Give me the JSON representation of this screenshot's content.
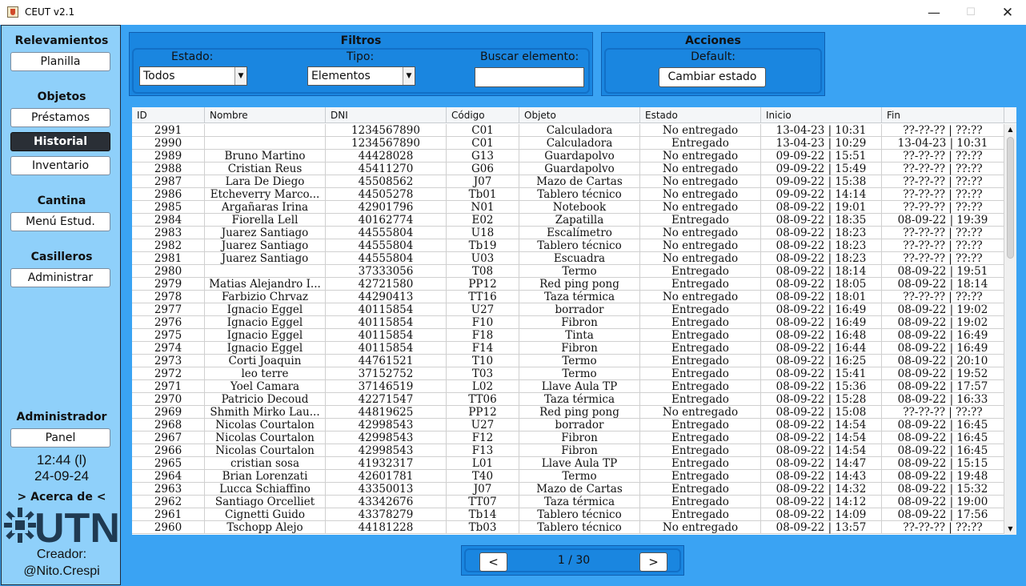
{
  "window": {
    "title": "CEUT v2.1",
    "min_icon": "—",
    "max_icon": "☐",
    "close_icon": "✕"
  },
  "sidebar": {
    "relevamientos": {
      "heading": "Relevamientos",
      "planilla": "Planilla"
    },
    "objetos": {
      "heading": "Objetos",
      "prestamos": "Préstamos",
      "historial": "Historial",
      "inventario": "Inventario"
    },
    "cantina": {
      "heading": "Cantina",
      "menu": "Menú Estud."
    },
    "casilleros": {
      "heading": "Casilleros",
      "administrar": "Administrar"
    },
    "administrador": {
      "heading": "Administrador",
      "panel": "Panel"
    },
    "clock_time": "12:44 (l)",
    "clock_date": "24-09-24",
    "acerca": "> Acerca de <",
    "logo_text": "UTN",
    "creador_label": "Creador:",
    "creador_name": "@Nito.Crespi"
  },
  "filtros": {
    "title": "Filtros",
    "estado_label": "Estado:",
    "estado_value": "Todos",
    "tipo_label": "Tipo:",
    "tipo_value": "Elementos",
    "buscar_label": "Buscar elemento:",
    "buscar_value": ""
  },
  "acciones": {
    "title": "Acciones",
    "default_label": "Default:",
    "cambiar_label": "Cambiar estado"
  },
  "table": {
    "columns": [
      "ID",
      "Nombre",
      "DNI",
      "Código",
      "Objeto",
      "Estado",
      "Inicio",
      "Fin"
    ],
    "rows": [
      [
        "2991",
        "",
        "1234567890",
        "C01",
        "Calculadora",
        "No entregado",
        "13-04-23 | 10:31",
        "??-??-?? | ??:??"
      ],
      [
        "2990",
        "",
        "1234567890",
        "C01",
        "Calculadora",
        "Entregado",
        "13-04-23 | 10:29",
        "13-04-23 | 10:31"
      ],
      [
        "2989",
        "Bruno Martino",
        "44428028",
        "G13",
        "Guardapolvo",
        "No entregado",
        "09-09-22 | 15:51",
        "??-??-?? | ??:??"
      ],
      [
        "2988",
        "Cristian Reus",
        "45411270",
        "G06",
        "Guardapolvo",
        "No entregado",
        "09-09-22 | 15:49",
        "??-??-?? | ??:??"
      ],
      [
        "2987",
        "Lara De Diego",
        "45508562",
        "J07",
        "Mazo de Cartas",
        "No entregado",
        "09-09-22 | 15:38",
        "??-??-?? | ??:??"
      ],
      [
        "2986",
        "Etcheverry Marco...",
        "44505278",
        "Tb01",
        "Tablero técnico",
        "No entregado",
        "09-09-22 | 14:14",
        "??-??-?? | ??:??"
      ],
      [
        "2985",
        "Argañaras Irina",
        "42901796",
        "N01",
        "Notebook",
        "No entregado",
        "08-09-22 | 19:01",
        "??-??-?? | ??:??"
      ],
      [
        "2984",
        "Fiorella Lell",
        "40162774",
        "E02",
        "Zapatilla",
        "Entregado",
        "08-09-22 | 18:35",
        "08-09-22 | 19:39"
      ],
      [
        "2983",
        "Juarez Santiago",
        "44555804",
        "U18",
        "Escalímetro",
        "No entregado",
        "08-09-22 | 18:23",
        "??-??-?? | ??:??"
      ],
      [
        "2982",
        "Juarez Santiago",
        "44555804",
        "Tb19",
        "Tablero técnico",
        "No entregado",
        "08-09-22 | 18:23",
        "??-??-?? | ??:??"
      ],
      [
        "2981",
        "Juarez Santiago",
        "44555804",
        "U03",
        "Escuadra",
        "No entregado",
        "08-09-22 | 18:23",
        "??-??-?? | ??:??"
      ],
      [
        "2980",
        "",
        "37333056",
        "T08",
        "Termo",
        "Entregado",
        "08-09-22 | 18:14",
        "08-09-22 | 19:51"
      ],
      [
        "2979",
        "Matias Alejandro I...",
        "42721580",
        "PP12",
        "Red ping pong",
        "Entregado",
        "08-09-22 | 18:05",
        "08-09-22 | 18:14"
      ],
      [
        "2978",
        "Farbizio Chrvaz",
        "44290413",
        "TT16",
        "Taza térmica",
        "No entregado",
        "08-09-22 | 18:01",
        "??-??-?? | ??:??"
      ],
      [
        "2977",
        "Ignacio Eggel",
        "40115854",
        "U27",
        "borrador",
        "Entregado",
        "08-09-22 | 16:49",
        "08-09-22 | 19:02"
      ],
      [
        "2976",
        "Ignacio Eggel",
        "40115854",
        "F10",
        "Fibron",
        "Entregado",
        "08-09-22 | 16:49",
        "08-09-22 | 19:02"
      ],
      [
        "2975",
        "Ignacio Eggel",
        "40115854",
        "F18",
        "Tinta",
        "Entregado",
        "08-09-22 | 16:48",
        "08-09-22 | 16:49"
      ],
      [
        "2974",
        "Ignacio Eggel",
        "40115854",
        "F14",
        "Fibron",
        "Entregado",
        "08-09-22 | 16:44",
        "08-09-22 | 16:49"
      ],
      [
        "2973",
        "Corti Joaquin",
        "44761521",
        "T10",
        "Termo",
        "Entregado",
        "08-09-22 | 16:25",
        "08-09-22 | 20:10"
      ],
      [
        "2972",
        "leo terre",
        "37152752",
        "T03",
        "Termo",
        "Entregado",
        "08-09-22 | 15:41",
        "08-09-22 | 19:52"
      ],
      [
        "2971",
        "Yoel Camara",
        "37146519",
        "L02",
        "Llave Aula TP",
        "Entregado",
        "08-09-22 | 15:36",
        "08-09-22 | 17:57"
      ],
      [
        "2970",
        "Patricio Decoud",
        "42271547",
        "TT06",
        "Taza térmica",
        "Entregado",
        "08-09-22 | 15:28",
        "08-09-22 | 16:33"
      ],
      [
        "2969",
        "Shmith Mirko Lau...",
        "44819625",
        "PP12",
        "Red ping pong",
        "No entregado",
        "08-09-22 | 15:08",
        "??-??-?? | ??:??"
      ],
      [
        "2968",
        "Nicolas Courtalon",
        "42998543",
        "U27",
        "borrador",
        "Entregado",
        "08-09-22 | 14:54",
        "08-09-22 | 16:45"
      ],
      [
        "2967",
        "Nicolas Courtalon",
        "42998543",
        "F12",
        "Fibron",
        "Entregado",
        "08-09-22 | 14:54",
        "08-09-22 | 16:45"
      ],
      [
        "2966",
        "Nicolas Courtalon",
        "42998543",
        "F13",
        "Fibron",
        "Entregado",
        "08-09-22 | 14:54",
        "08-09-22 | 16:45"
      ],
      [
        "2965",
        "cristian sosa",
        "41932317",
        "L01",
        "Llave Aula TP",
        "Entregado",
        "08-09-22 | 14:47",
        "08-09-22 | 15:15"
      ],
      [
        "2964",
        "Brian Lorenzati",
        "42601781",
        "T40",
        "Termo",
        "Entregado",
        "08-09-22 | 14:43",
        "08-09-22 | 19:48"
      ],
      [
        "2963",
        "Lucca Schiaffino",
        "43350013",
        "J07",
        "Mazo de Cartas",
        "Entregado",
        "08-09-22 | 14:32",
        "08-09-22 | 15:32"
      ],
      [
        "2962",
        "Santiago Orcelliet",
        "43342676",
        "TT07",
        "Taza térmica",
        "Entregado",
        "08-09-22 | 14:12",
        "08-09-22 | 19:00"
      ],
      [
        "2961",
        "Cignetti Guido",
        "43378279",
        "Tb14",
        "Tablero técnico",
        "Entregado",
        "08-09-22 | 14:09",
        "08-09-22 | 17:56"
      ],
      [
        "2960",
        "Tschopp Alejo",
        "44181228",
        "Tb03",
        "Tablero técnico",
        "No entregado",
        "08-09-22 | 13:57",
        "??-??-?? | ??:??"
      ]
    ]
  },
  "pager": {
    "prev": "<",
    "next": ">",
    "indicator": "1 / 30"
  },
  "colors": {
    "background": "#3aa3f3",
    "sidebar": "#8fd0fa",
    "panel": "#1a86e0",
    "active_button": "#2a2f36",
    "logo": "#1f3a52"
  }
}
